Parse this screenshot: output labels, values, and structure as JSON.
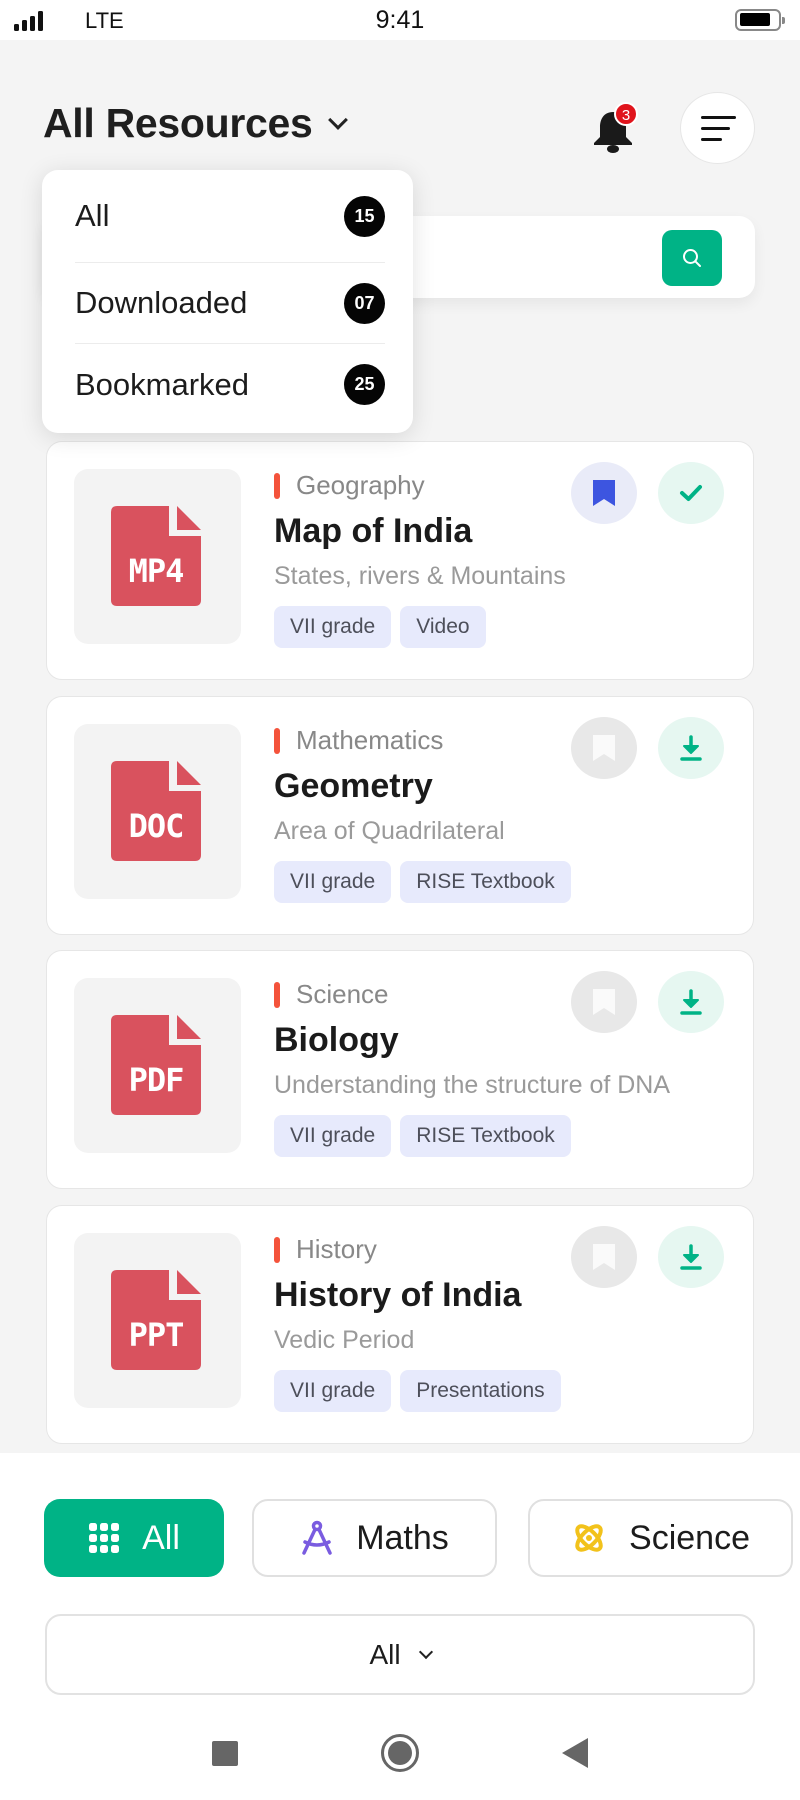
{
  "status_bar": {
    "carrier": "LTE",
    "time": "9:41"
  },
  "header": {
    "title": "All Resources",
    "notification_count": "3"
  },
  "search": {
    "value": "",
    "placeholder": ""
  },
  "filter_dropdown": {
    "items": [
      {
        "label": "All",
        "count": "15"
      },
      {
        "label": "Downloaded",
        "count": "07"
      },
      {
        "label": "Bookmarked",
        "count": "25"
      }
    ]
  },
  "resources": [
    {
      "file_type": "MP4",
      "subject": "Geography",
      "title": "Map of India",
      "subtitle": "States, rivers & Mountains",
      "tags": [
        "VII grade",
        "Video"
      ],
      "bookmarked": true,
      "downloaded": true
    },
    {
      "file_type": "DOC",
      "subject": "Mathematics",
      "title": "Geometry",
      "subtitle": "Area of Quadrilateral",
      "tags": [
        "VII grade",
        "RISE Textbook"
      ],
      "bookmarked": false,
      "downloaded": false
    },
    {
      "file_type": "PDF",
      "subject": "Science",
      "title": "Biology",
      "subtitle": "Understanding the structure of DNA",
      "tags": [
        "VII grade",
        "RISE Textbook"
      ],
      "bookmarked": false,
      "downloaded": false
    },
    {
      "file_type": "PPT",
      "subject": "History",
      "title": "History of India",
      "subtitle": "Vedic Period",
      "tags": [
        "VII grade",
        "Presentations"
      ],
      "bookmarked": false,
      "downloaded": false
    }
  ],
  "subject_chips": [
    {
      "label": "All",
      "icon": "grid-icon",
      "selected": true
    },
    {
      "label": "Maths",
      "icon": "compass-icon",
      "selected": false
    },
    {
      "label": "Science",
      "icon": "atom-icon",
      "selected": false
    }
  ],
  "grade_select": {
    "value": "All"
  },
  "colors": {
    "accent": "#00b386",
    "file_icon": "#d9525e",
    "bookmark_active": "#3d55e0",
    "subject_marker": "#f4533b",
    "badge": "#e0141c",
    "maths_icon": "#7a5ce0",
    "science_icon": "#f2c21b"
  }
}
